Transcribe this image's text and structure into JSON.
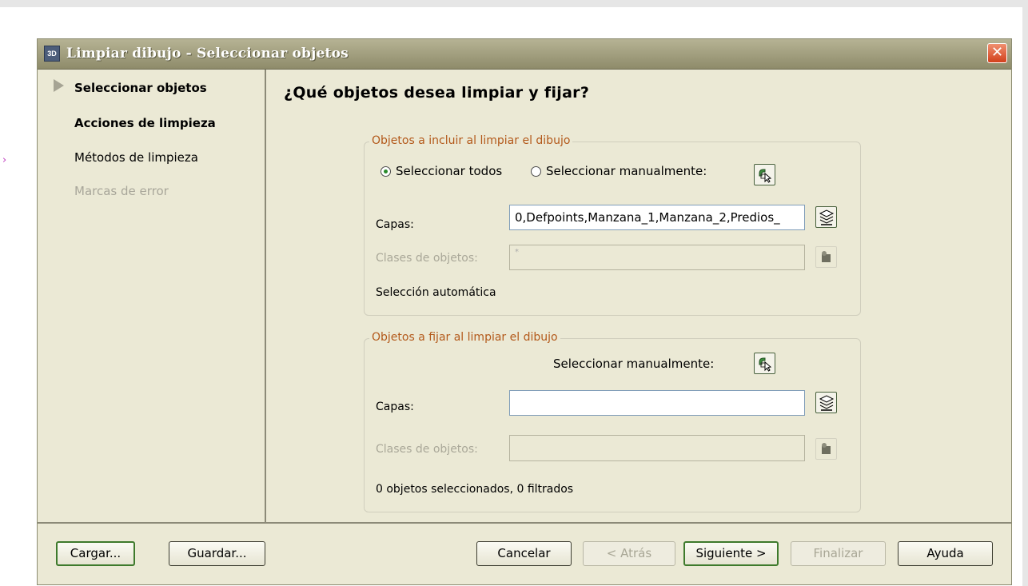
{
  "window": {
    "title": "Limpiar dibujo - Seleccionar objetos",
    "app_icon_text": "3D",
    "close_glyph": "✕"
  },
  "background": {
    "side_marker": "›"
  },
  "nav": {
    "items": [
      {
        "label": "Seleccionar objetos",
        "state": "current"
      },
      {
        "label": "Acciones de limpieza",
        "state": "bold"
      },
      {
        "label": "Métodos de limpieza",
        "state": "normal"
      },
      {
        "label": "Marcas de error",
        "state": "disabled"
      }
    ]
  },
  "main": {
    "heading": "¿Qué objetos desea limpiar y fijar?",
    "include_group": {
      "legend": "Objetos a incluir al limpiar el dibujo",
      "radio_all": "Seleccionar todos",
      "radio_manual": "Seleccionar manualmente:",
      "selected_option": "Seleccionar todos",
      "layers_label": "Capas:",
      "layers_value": "0,Defpoints,Manzana_1,Manzana_2,Predios_",
      "classes_label": "Clases de objetos:",
      "classes_value": "*",
      "status": "Selección automática"
    },
    "fix_group": {
      "legend": "Objetos a fijar al limpiar el dibujo",
      "manual_label": "Seleccionar manualmente:",
      "layers_label": "Capas:",
      "layers_value": "",
      "classes_label": "Clases de objetos:",
      "classes_value": "",
      "status": "0 objetos seleccionados, 0 filtrados"
    }
  },
  "buttons": {
    "load": "Cargar...",
    "save": "Guardar...",
    "cancel": "Cancelar",
    "back": "< Atrás",
    "next": "Siguiente >",
    "finish": "Finalizar",
    "help": "Ayuda"
  },
  "icons": {
    "select_objects": "select-objects-icon",
    "layer_list": "layer-list-icon",
    "object_class": "object-class-icon"
  }
}
